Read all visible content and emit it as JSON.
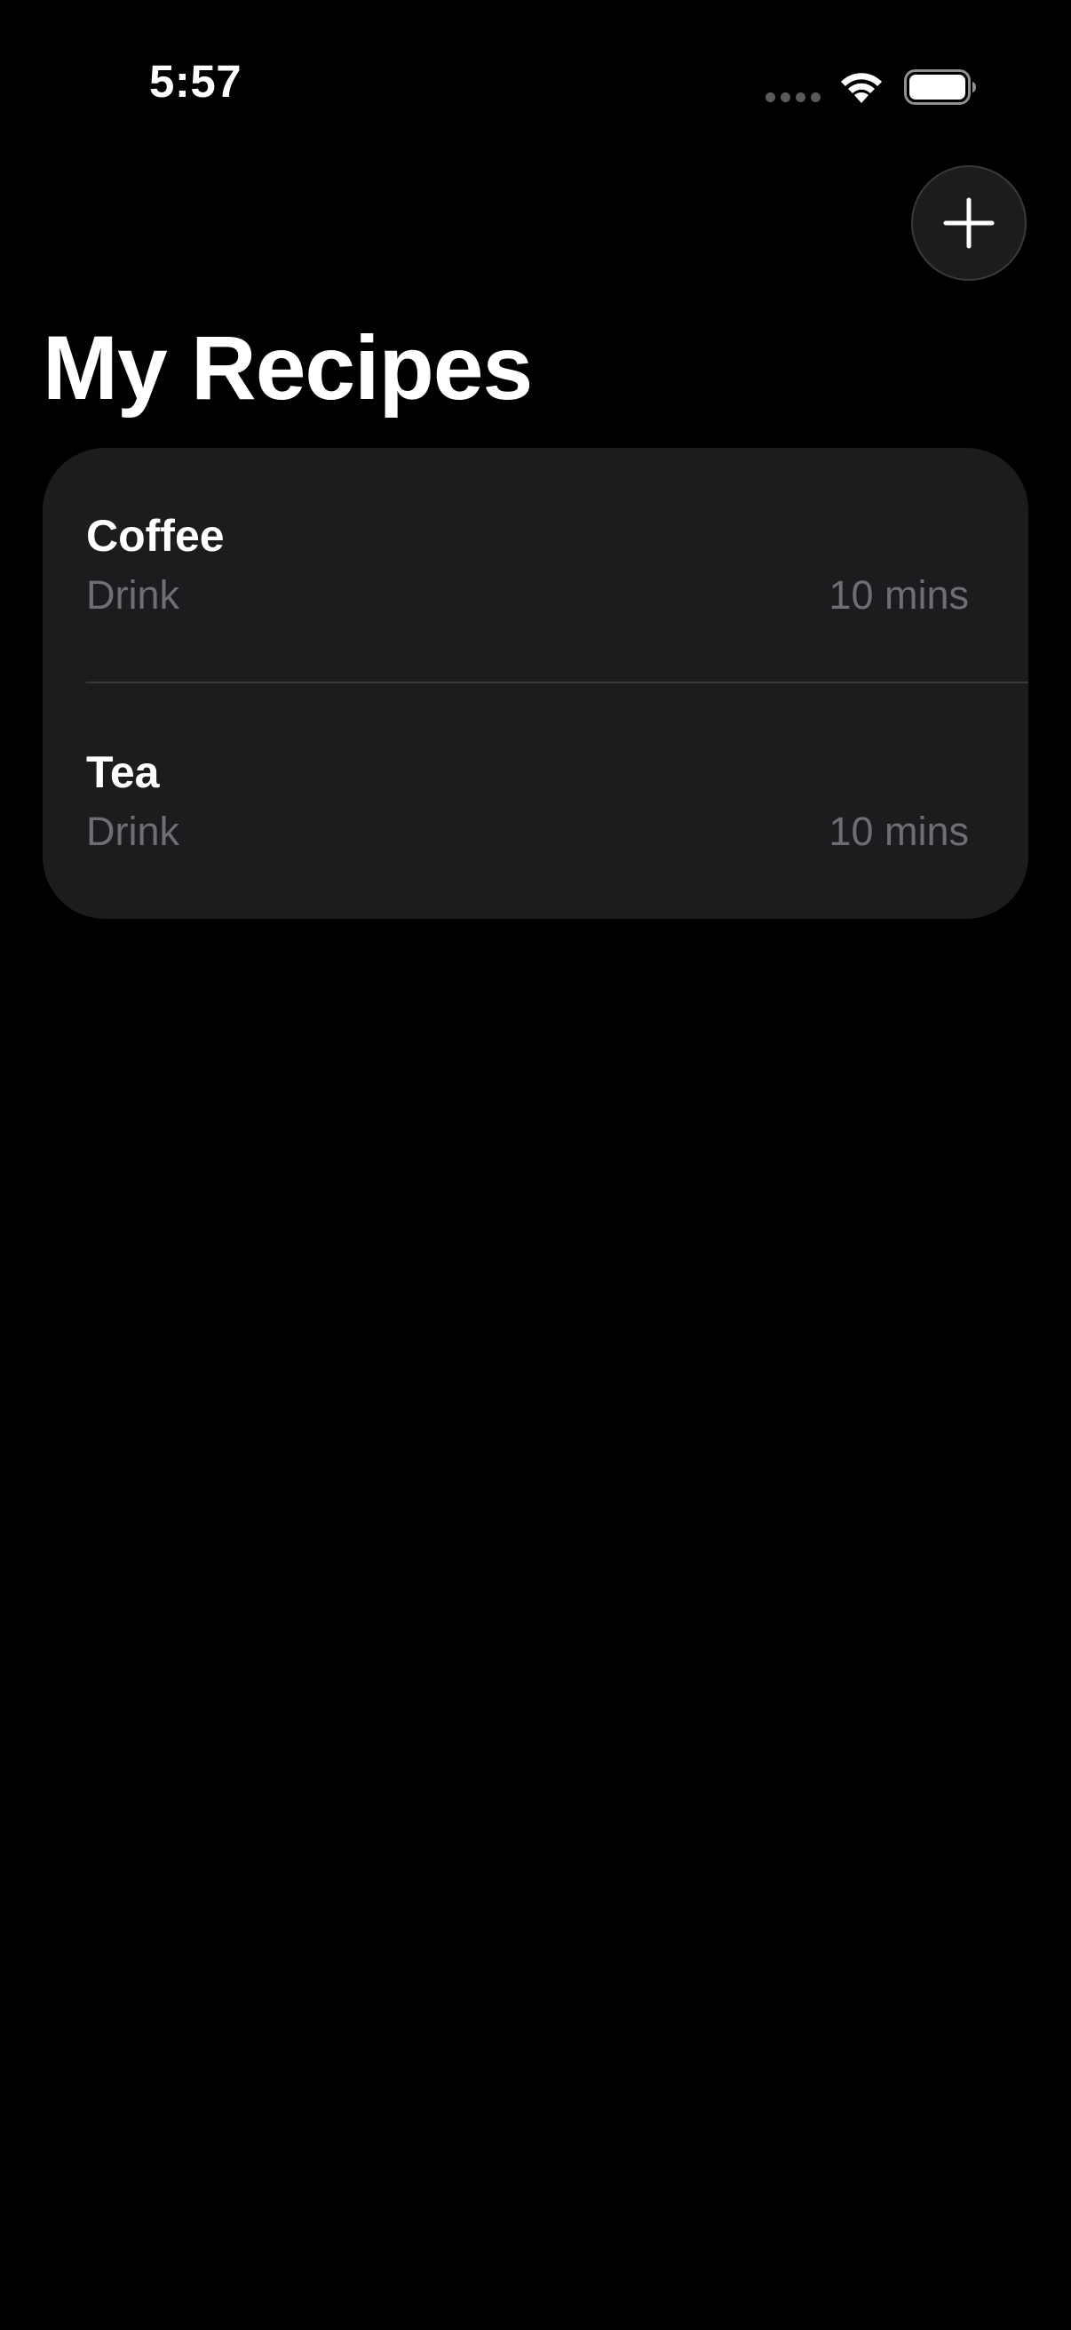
{
  "status_bar": {
    "time": "5:57",
    "icons": [
      "signal-dots-icon",
      "wifi-icon",
      "battery-icon"
    ]
  },
  "toolbar": {
    "add_button_icon": "plus-icon"
  },
  "header": {
    "title": "My Recipes"
  },
  "recipes": [
    {
      "name": "Coffee",
      "category": "Drink",
      "time": "10 mins"
    },
    {
      "name": "Tea",
      "category": "Drink",
      "time": "10 mins"
    }
  ],
  "colors": {
    "background": "#000000",
    "card": "#1c1c1e",
    "primary_text": "#ffffff",
    "secondary_text": "#6e6e73",
    "divider": "#3a3a3c"
  }
}
